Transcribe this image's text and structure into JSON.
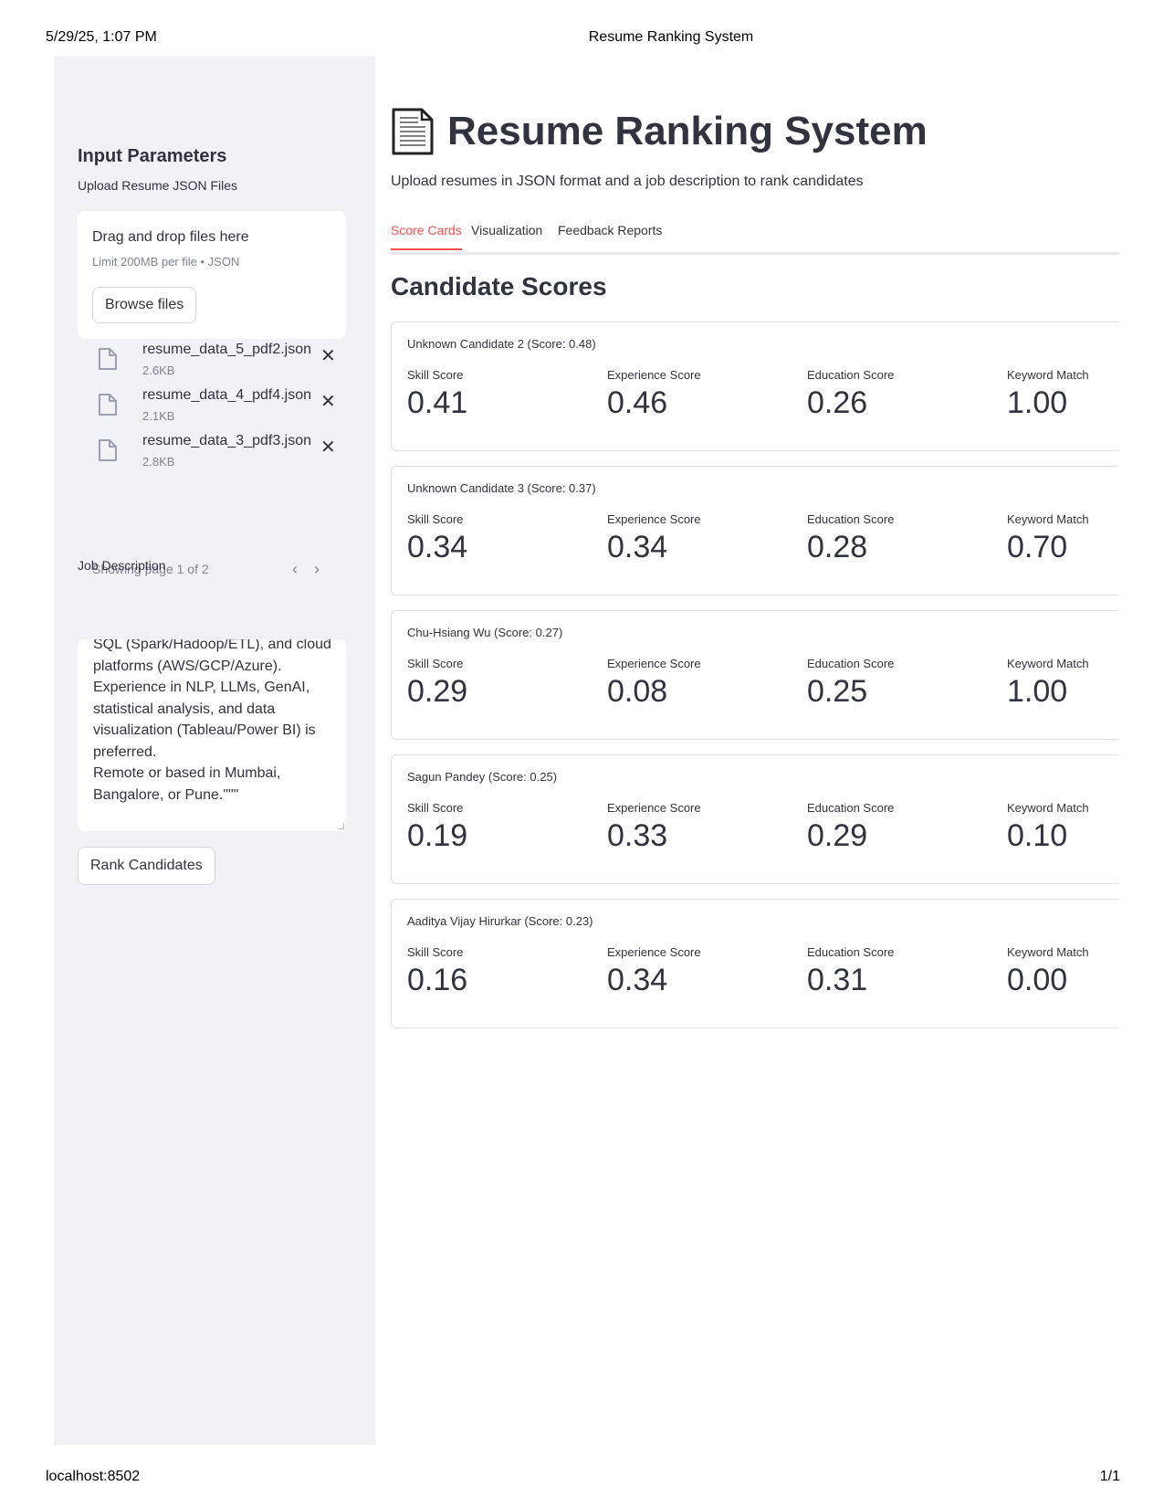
{
  "print": {
    "datetime": "5/29/25, 1:07 PM",
    "page_title": "Resume Ranking System",
    "url": "localhost:8502",
    "page_number": "1/1"
  },
  "sidebar": {
    "title": "Input Parameters",
    "upload_label": "Upload Resume JSON Files",
    "dropzone_title": "Drag and drop files here",
    "dropzone_limit": "Limit 200MB per file • JSON",
    "browse_label": "Browse files",
    "files": [
      {
        "name": "resume_data_5_pdf2.json",
        "size": "2.6KB"
      },
      {
        "name": "resume_data_4_pdf4.json",
        "size": "2.1KB"
      },
      {
        "name": "resume_data_3_pdf3.json",
        "size": "2.8KB"
      }
    ],
    "pager_text": "Showing page 1 of 2",
    "job_description_label": "Job Description",
    "job_description_text": "SQL (Spark/Hadoop/ETL), and cloud platforms (AWS/GCP/Azure).\nExperience in NLP, LLMs, GenAI, statistical analysis, and data visualization (Tableau/Power BI) is preferred.\nRemote or based in Mumbai, Bangalore, or Pune.\"\"\"",
    "rank_button_label": "Rank Candidates"
  },
  "main": {
    "title": "Resume Ranking System",
    "subtitle": "Upload resumes in JSON format and a job description to rank candidates",
    "tabs": [
      {
        "label": "Score Cards",
        "active": true
      },
      {
        "label": "Visualization",
        "active": false
      },
      {
        "label": "Feedback Reports",
        "active": false
      }
    ],
    "section_title": "Candidate Scores",
    "metric_labels": {
      "skill": "Skill Score",
      "experience": "Experience Score",
      "education": "Education Score",
      "keyword": "Keyword Match"
    },
    "candidates": [
      {
        "title": "Unknown Candidate 2 (Score: 0.48)",
        "skill": "0.41",
        "experience": "0.46",
        "education": "0.26",
        "keyword": "1.00"
      },
      {
        "title": "Unknown Candidate 3 (Score: 0.37)",
        "skill": "0.34",
        "experience": "0.34",
        "education": "0.28",
        "keyword": "0.70"
      },
      {
        "title": "Chu-Hsiang Wu (Score: 0.27)",
        "skill": "0.29",
        "experience": "0.08",
        "education": "0.25",
        "keyword": "1.00"
      },
      {
        "title": "Sagun Pandey (Score: 0.25)",
        "skill": "0.19",
        "experience": "0.33",
        "education": "0.29",
        "keyword": "0.10"
      },
      {
        "title": "Aaditya Vijay Hirurkar (Score: 0.23)",
        "skill": "0.16",
        "experience": "0.34",
        "education": "0.31",
        "keyword": "0.00"
      }
    ]
  },
  "icons": {
    "file": "file-icon",
    "remove": "close-icon",
    "prev": "chevron-left-icon",
    "next": "chevron-right-icon",
    "title": "page-facing-up-icon"
  },
  "colors": {
    "accent": "#ff4b4b",
    "sidebar_bg": "#f0f2f6",
    "text": "#31333f",
    "muted": "#808495"
  }
}
